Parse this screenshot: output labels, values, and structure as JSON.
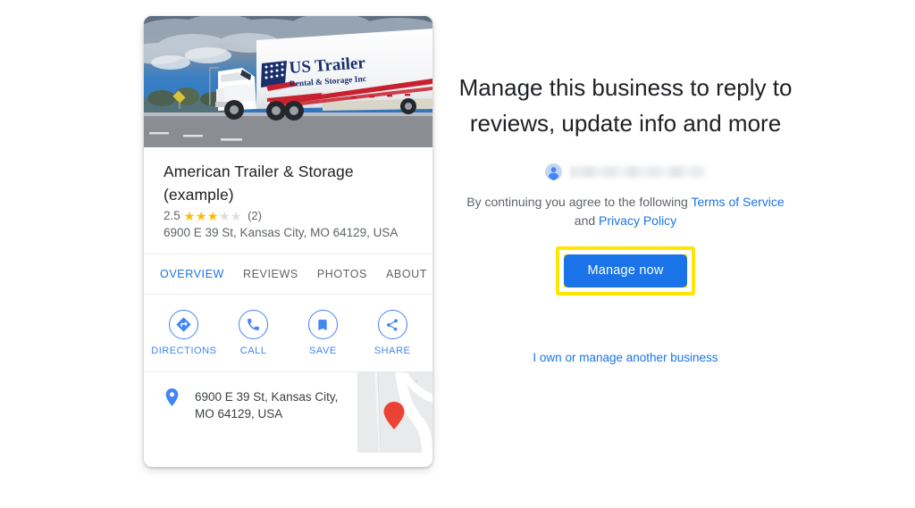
{
  "colors": {
    "google_blue": "#1a73e8",
    "action_blue": "#4285f4",
    "star_gold": "#fabb05",
    "star_empty": "#dadce0",
    "highlight_yellow": "#ffe500",
    "map_pin_red": "#ea4335",
    "text_primary": "#202124",
    "text_secondary": "#5f6368",
    "background": "#ffffff"
  },
  "business_card": {
    "photo": {
      "alt": "White semi truck with US Trailer Rental & Storage Inc trailer on highway",
      "trailer_logo_line1": "US Trailer",
      "trailer_logo_line2": "Rental & Storage Inc"
    },
    "name": "American Trailer & Storage (example)",
    "rating": {
      "value": "2.5",
      "stars_filled": 3,
      "stars_total": 5,
      "review_count": "(2)"
    },
    "address": "6900 E 39 St, Kansas City, MO 64129, USA",
    "tabs": [
      {
        "label": "OVERVIEW",
        "active": true
      },
      {
        "label": "REVIEWS",
        "active": false
      },
      {
        "label": "PHOTOS",
        "active": false
      },
      {
        "label": "ABOUT",
        "active": false
      }
    ],
    "actions": [
      {
        "label": "DIRECTIONS",
        "icon": "directions-icon"
      },
      {
        "label": "CALL",
        "icon": "phone-icon"
      },
      {
        "label": "SAVE",
        "icon": "bookmark-icon"
      },
      {
        "label": "SHARE",
        "icon": "share-icon"
      }
    ],
    "address_row": {
      "icon": "location-pin-icon",
      "text": "6900 E 39 St, Kansas City, MO 64129, USA",
      "map_thumbnail_alt": "Map thumbnail with red location marker"
    }
  },
  "manage_panel": {
    "title": "Manage this business to reply to reviews, update info and more",
    "account": {
      "avatar_icon": "account-avatar-icon",
      "email": "",
      "email_redacted": true
    },
    "terms": {
      "prefix": "By continuing you agree to the following ",
      "terms_link": "Terms of Service",
      "middle": " and ",
      "privacy_link": "Privacy Policy"
    },
    "primary_button": {
      "label": "Manage now",
      "highlighted": true
    },
    "secondary_link": "I own or manage another business"
  }
}
